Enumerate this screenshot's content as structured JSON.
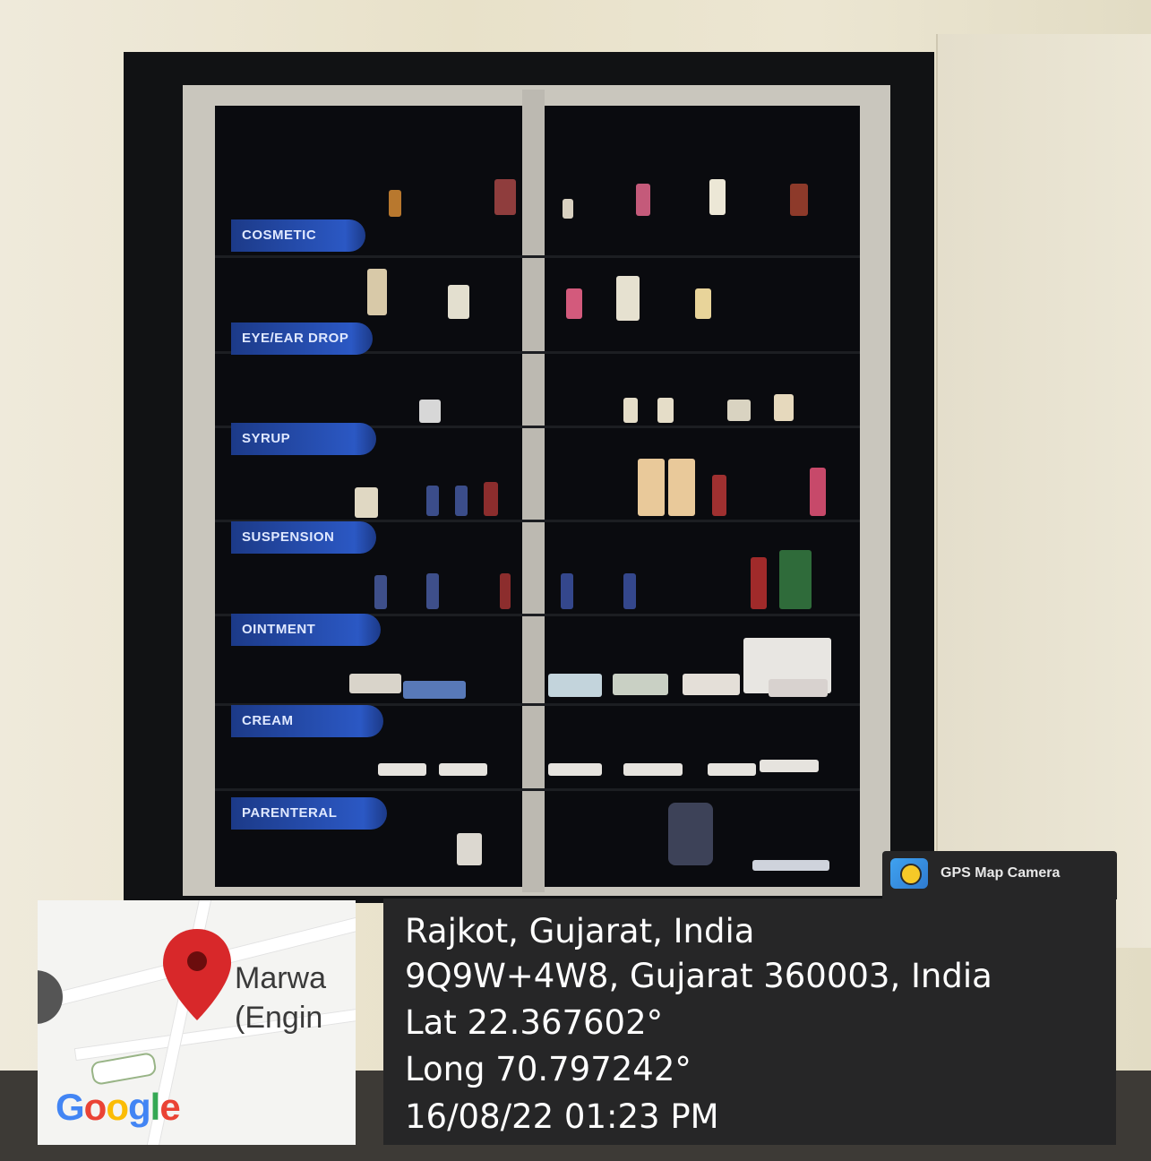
{
  "shelf_labels": [
    "COSMETIC",
    "EYE/EAR DROP",
    "SYRUP",
    "SUSPENSION",
    "OINTMENT",
    "CREAM",
    "PARENTERAL"
  ],
  "map": {
    "place_name_line1": "Marwa",
    "place_name_line2": "(Engin",
    "logo_text": "Google"
  },
  "gps_tag": {
    "icon": "gps-map-camera-icon",
    "label": "GPS Map Camera"
  },
  "location": {
    "city": "Rajkot, Gujarat, India",
    "address": "9Q9W+4W8, Gujarat 360003, India",
    "latitude": "Lat 22.367602°",
    "longitude": "Long 70.797242°",
    "timestamp": "16/08/22 01:23 PM"
  },
  "colors": {
    "label_blue": "#2b58c4",
    "overlay_dark": "#262627",
    "pin_red": "#d8282a"
  }
}
